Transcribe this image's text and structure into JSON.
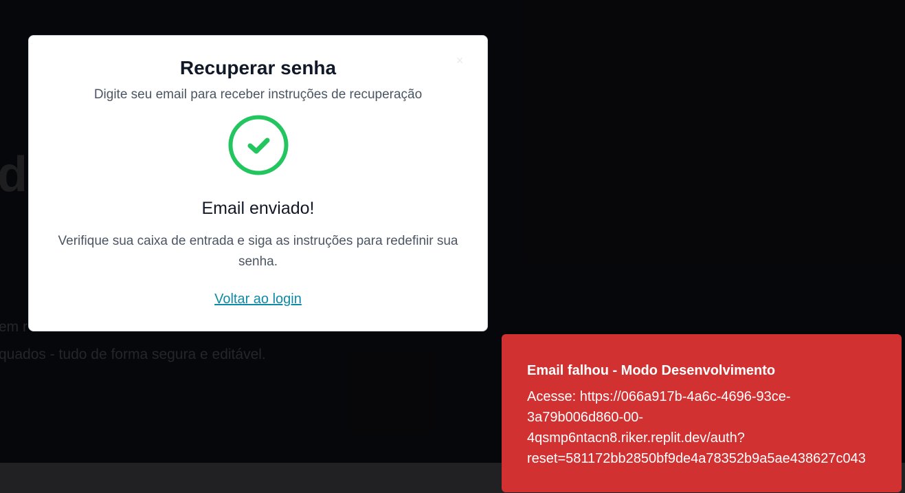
{
  "background": {
    "heading_fragment": "da",
    "paragraph_line1": "em r",
    "paragraph_line2": "quados - tudo de forma segura e editável."
  },
  "modal": {
    "title": "Recuperar senha",
    "subtitle": "Digite seu email para receber instruções de recuperação",
    "close_symbol": "×",
    "success_title": "Email enviado!",
    "success_text": "Verifique sua caixa de entrada e siga as instruções para redefinir sua senha.",
    "back_link": "Voltar ao login",
    "icon": "check-circle-icon",
    "icon_color": "#22c55e"
  },
  "toast": {
    "title": "Email falhou - Modo Desenvolvimento",
    "message_line1": "Acesse: https://066a917b-4a6c-4696-93ce-",
    "message_line2": "3a79b006d860-00-",
    "message_line3": "4qsmp6ntacn8.riker.replit.dev/auth?",
    "message_line4": "reset=581172bb2850bf9de4a78352b9a5ae438627c043",
    "color": "#d13131"
  }
}
